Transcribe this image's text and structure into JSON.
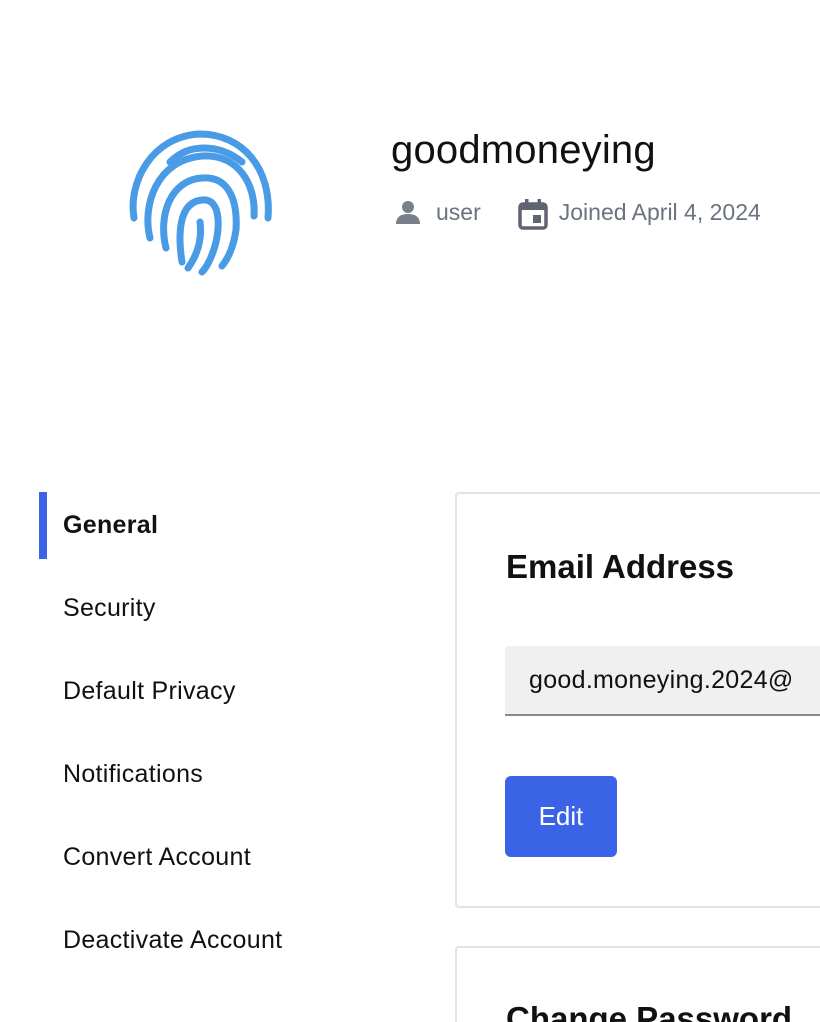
{
  "profile": {
    "username": "goodmoneying",
    "role": "user",
    "joined": "Joined April 4, 2024",
    "avatar_icon": "fingerprint-icon"
  },
  "colors": {
    "accent": "#3b63e6",
    "fingerprint": "#4a9be6",
    "muted_text": "#6b7280"
  },
  "sidebar": {
    "items": [
      {
        "label": "General",
        "active": true
      },
      {
        "label": "Security",
        "active": false
      },
      {
        "label": "Default Privacy",
        "active": false
      },
      {
        "label": "Notifications",
        "active": false
      },
      {
        "label": "Convert Account",
        "active": false
      },
      {
        "label": "Deactivate Account",
        "active": false
      }
    ]
  },
  "email_section": {
    "title": "Email Address",
    "value": "good.moneying.2024@",
    "edit_label": "Edit"
  },
  "password_section": {
    "title": "Change Password"
  }
}
